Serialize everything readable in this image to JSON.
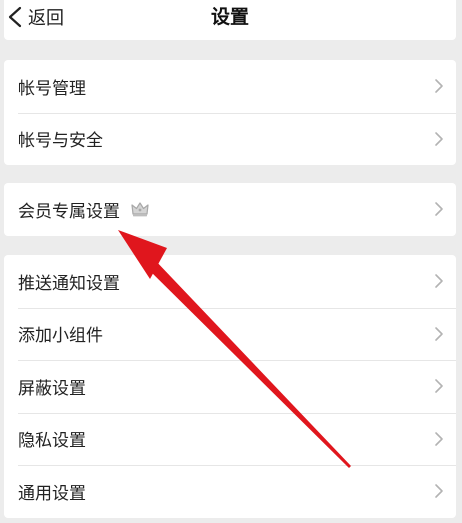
{
  "nav": {
    "back_label": "返回",
    "title": "设置"
  },
  "groups": [
    {
      "items": [
        {
          "label": "帐号管理"
        },
        {
          "label": "帐号与安全"
        }
      ]
    },
    {
      "items": [
        {
          "label": "会员专属设置",
          "badge_icon": "crown-icon"
        }
      ]
    },
    {
      "items": [
        {
          "label": "推送通知设置"
        },
        {
          "label": "添加小组件"
        },
        {
          "label": "屏蔽设置"
        },
        {
          "label": "隐私设置"
        },
        {
          "label": "通用设置"
        }
      ]
    }
  ],
  "colors": {
    "background": "#ececec",
    "card": "#ffffff",
    "annotation_arrow": "#e0161d",
    "chevron": "#b3b3b3"
  }
}
